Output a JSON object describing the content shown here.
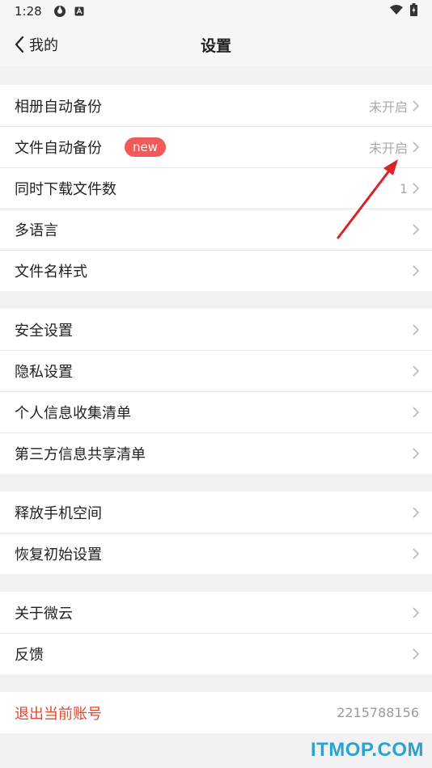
{
  "status_bar": {
    "time": "1:28"
  },
  "nav": {
    "back_label": "我的",
    "title": "设置"
  },
  "groups": [
    [
      {
        "label": "相册自动备份",
        "value": "未开启"
      },
      {
        "label": "文件自动备份",
        "badge": "new",
        "value": "未开启"
      },
      {
        "label": "同时下载文件数",
        "value": "1"
      },
      {
        "label": "多语言"
      },
      {
        "label": "文件名样式"
      }
    ],
    [
      {
        "label": "安全设置"
      },
      {
        "label": "隐私设置"
      },
      {
        "label": "个人信息收集清单"
      },
      {
        "label": "第三方信息共享清单"
      }
    ],
    [
      {
        "label": "释放手机空间"
      },
      {
        "label": "恢复初始设置"
      }
    ],
    [
      {
        "label": "关于微云"
      },
      {
        "label": "反馈"
      }
    ]
  ],
  "logout": {
    "label": "退出当前账号",
    "account": "2215788156"
  },
  "watermark": "ITMOP.COM",
  "colors": {
    "badge": "#f25a5a",
    "logout_text": "#e4462f",
    "annotation_arrow": "#d8232a"
  }
}
